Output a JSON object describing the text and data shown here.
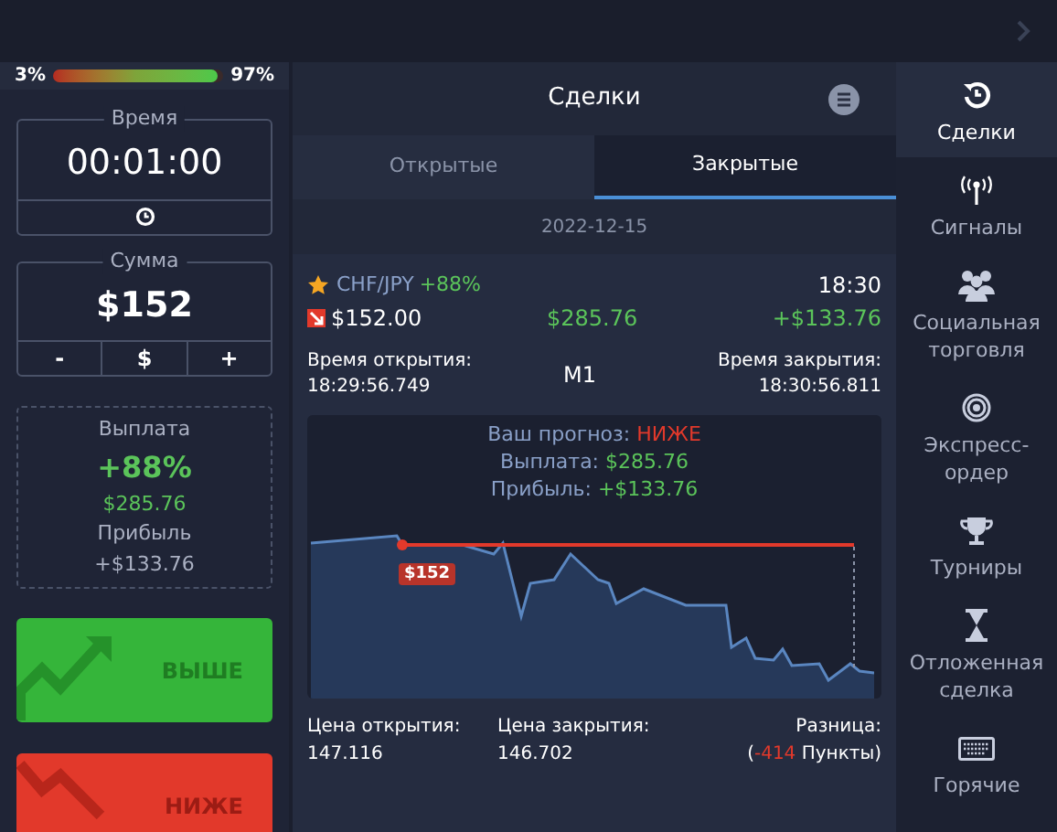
{
  "sentiment": {
    "low": "3%",
    "high": "97%",
    "level": 0.97
  },
  "time": {
    "label": "Время",
    "value": "00:01:00"
  },
  "amount": {
    "label": "Сумма",
    "value": "$152",
    "buttons": [
      "-",
      "$",
      "+"
    ]
  },
  "payout": {
    "label": "Выплата",
    "percent": "+88%",
    "amount": "$285.76",
    "profit_label": "Прибыль",
    "profit": "+$133.76"
  },
  "actions": [
    {
      "kind": "up",
      "label": "ВЫШЕ"
    },
    {
      "kind": "down",
      "label": "НИЖЕ"
    }
  ],
  "panel": {
    "title": "Сделки",
    "tabs": [
      {
        "label": "Открытые",
        "selected": false
      },
      {
        "label": "Закрытые",
        "selected": true
      }
    ],
    "date": "2022-12-15"
  },
  "trade": {
    "asset": "CHF/JPY",
    "asset_payout": "+88%",
    "time": "18:30",
    "kind": "down",
    "amount": "$152.00",
    "payout": "$285.76",
    "profit": "+$133.76",
    "open_label": "Время открытия:",
    "open_time": "18:29:56.749",
    "timeframe": "M1",
    "close_label": "Время закрытия:",
    "close_time": "18:30:56.811",
    "forecast_label": "Ваш прогноз:",
    "forecast": "НИЖЕ",
    "payout_label": "Выплата:",
    "payout_value": "$285.76",
    "profit_label": "Прибыль:",
    "profit_value": "+$133.76",
    "strike_label": "$152",
    "open_price_label": "Цена открытия:",
    "open_price": "147.116",
    "close_price_label": "Цена закрытия:",
    "close_price": "146.702",
    "difference_label": "Разница:",
    "difference_open": "(",
    "difference_value": "-414",
    "difference_unit": "Пункты)"
  },
  "nav": [
    {
      "kind": "history",
      "label": "Сделки",
      "selected": true
    },
    {
      "kind": "signal",
      "label": "Сигналы",
      "selected": false
    },
    {
      "kind": "people",
      "label": "Социальная торговля",
      "selected": false
    },
    {
      "kind": "target",
      "label": "Экспресс-ордер",
      "selected": false
    },
    {
      "kind": "trophy",
      "label": "Турниры",
      "selected": false
    },
    {
      "kind": "hourglass",
      "label": "Отложенная сделка",
      "selected": false
    },
    {
      "kind": "keyboard",
      "label": "Горячие",
      "selected": false
    }
  ]
}
